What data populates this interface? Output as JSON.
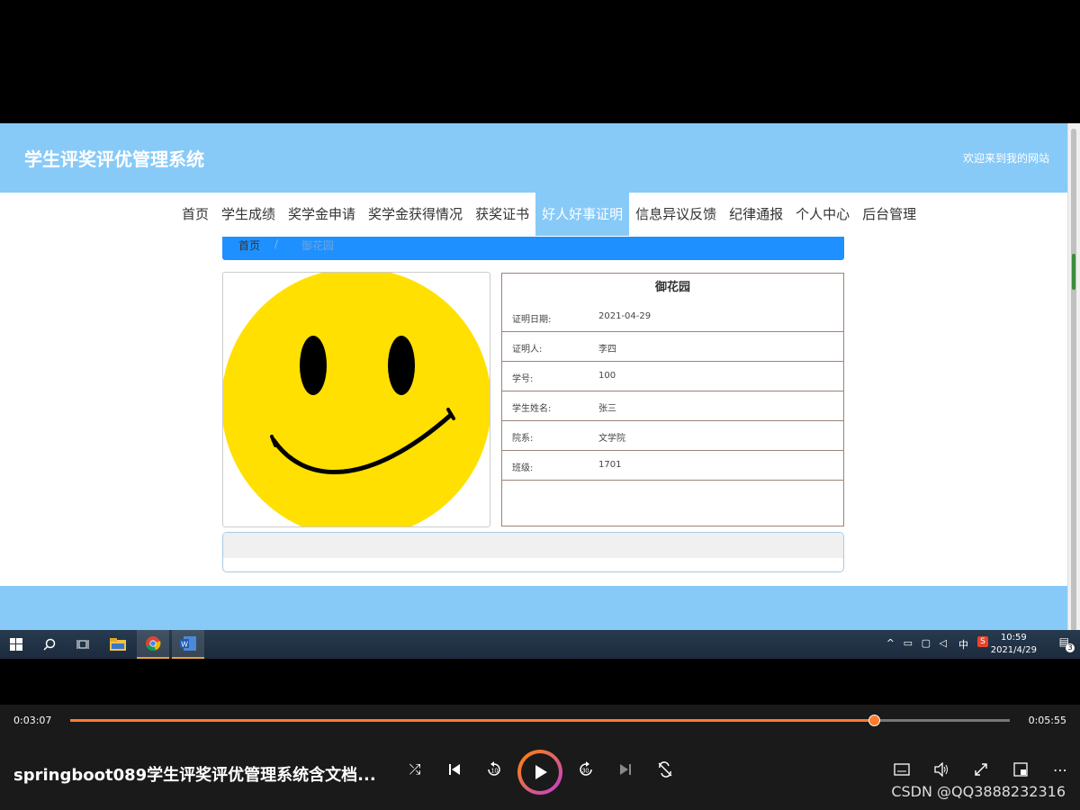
{
  "site": {
    "title": "学生评奖评优管理系统",
    "welcome": "欢迎来到我的网站"
  },
  "nav": {
    "items": [
      "首页",
      "学生成绩",
      "奖学金申请",
      "奖学金获得情况",
      "获奖证书",
      "好人好事证明",
      "信息异议反馈",
      "纪律通报",
      "个人中心",
      "后台管理"
    ],
    "active": "好人好事证明"
  },
  "breadcrumb": {
    "home": "首页",
    "separator": "/",
    "current": "御花园"
  },
  "detail": {
    "title": "御花园",
    "rows": [
      {
        "label": "证明日期:",
        "value": "2021-04-29"
      },
      {
        "label": "证明人:",
        "value": "李四"
      },
      {
        "label": "学号:",
        "value": "100"
      },
      {
        "label": "学生姓名:",
        "value": "张三"
      },
      {
        "label": "院系:",
        "value": "文学院"
      },
      {
        "label": "班级:",
        "value": "1701"
      }
    ]
  },
  "taskbar": {
    "time": "10:59",
    "date": "2021/4/29",
    "ime": "中",
    "notifications": "3"
  },
  "player": {
    "current_time": "0:03:07",
    "total_time": "0:05:55",
    "progress": 0.856,
    "video_title": "springboot089学生评奖评优管理系统含文档...",
    "watermark": "CSDN @QQ3888232316"
  },
  "colors": {
    "header": "#87caf8",
    "breadcrumb": "#1e90ff",
    "accent": "#ff7a2f"
  }
}
